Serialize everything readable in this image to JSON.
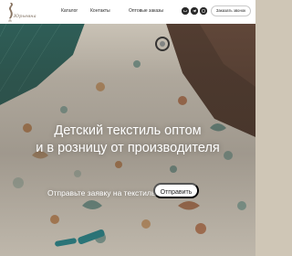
{
  "header": {
    "logo_text": "Юрьевна",
    "nav": {
      "catalog": "Каталог",
      "contacts": "Контакты",
      "wholesale": "Оптовые заказы"
    },
    "social": {
      "vk": "vk",
      "tg": "tg",
      "wa": "wa"
    },
    "call_button": "Заказать звонок"
  },
  "hero": {
    "title_line1": "Детский текстиль оптом",
    "title_line2": "и в розницу от производителя",
    "cta_text": "Отправьте заявку на текстиль",
    "cta_button": "Отправить"
  },
  "colors": {
    "header_bg": "#ffffff",
    "text_dark": "#2b2b2b",
    "social_icon_bg": "#2a2a2a",
    "hero_text": "#ffffff",
    "fabric_base": "#e4dccd",
    "cutting_mat": "#2f6a63"
  }
}
